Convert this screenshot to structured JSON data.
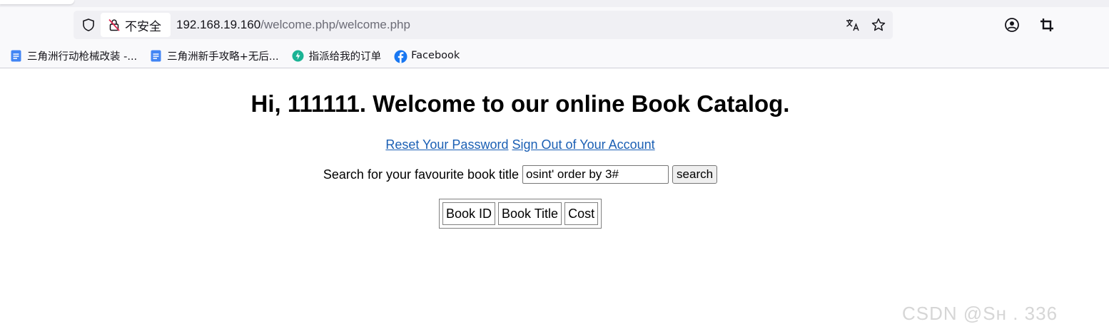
{
  "browser": {
    "security_label": "不安全",
    "url_host": "192.168.19.160",
    "url_path": "/welcome.php/welcome.php"
  },
  "bookmarks": [
    {
      "label": "三角洲行动枪械改装 -...",
      "icon": "doc-icon"
    },
    {
      "label": "三角洲新手攻略+无后...",
      "icon": "doc-icon"
    },
    {
      "label": "指派给我的订单",
      "icon": "bolt-icon"
    },
    {
      "label": "Facebook",
      "icon": "facebook-icon"
    }
  ],
  "page": {
    "greeting_prefix": "Hi, ",
    "username": "111111",
    "greeting_suffix": ". Welcome to our online Book Catalog.",
    "reset_link": "Reset Your Password",
    "signout_link": "Sign Out of Your Account",
    "search_label": "Search for your favourite book title",
    "search_value": "osint' order by 3#",
    "search_button": "search",
    "table_headers": [
      "Book ID",
      "Book Title",
      "Cost"
    ]
  },
  "watermark": "CSDN @Sн    . 336",
  "colors": {
    "link": "#1a5fb4",
    "toolbar_bg": "#f9f9fb",
    "urlbar_bg": "#f0f0f4"
  }
}
